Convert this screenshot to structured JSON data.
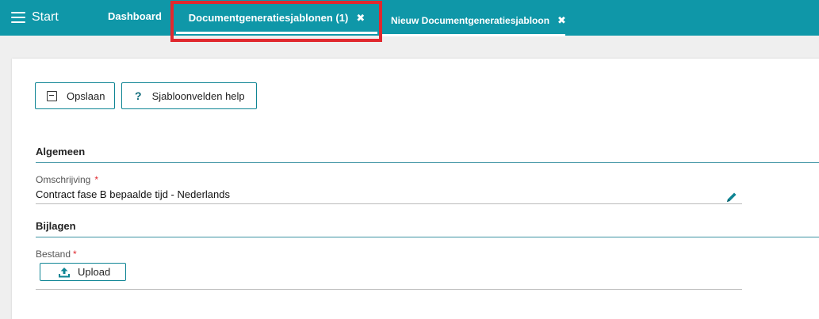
{
  "topbar": {
    "start_label": "Start",
    "tabs": [
      {
        "label": "Dashboard"
      },
      {
        "label": "Documentgeneratiesjablonen (1)",
        "close": "✖"
      },
      {
        "label": "Nieuw Documentgeneratiesjabloon",
        "close": "✖"
      }
    ]
  },
  "toolbar": {
    "save_label": "Opslaan",
    "help_label": "Sjabloonvelden help",
    "help_icon": "?"
  },
  "sections": {
    "general": "Algemeen",
    "attachments": "Bijlagen"
  },
  "fields": {
    "description": {
      "label": "Omschrijving",
      "required": "*",
      "value": "Contract fase B bepaalde tijd - Nederlands"
    },
    "file": {
      "label": "Bestand",
      "required": "*",
      "upload_label": "Upload"
    }
  },
  "colors": {
    "accent": "#0f97a8",
    "highlight": "#e0282e",
    "required": "#e0282e"
  }
}
